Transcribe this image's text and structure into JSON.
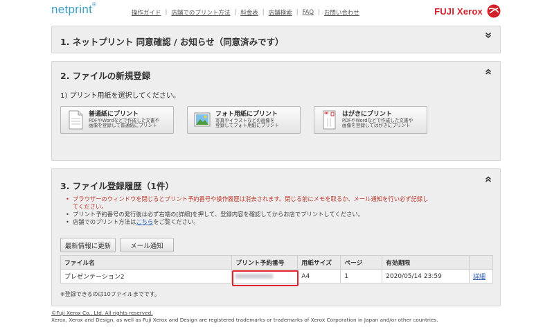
{
  "header": {
    "logo": "netprint",
    "logo_mark": "®",
    "nav": [
      "操作ガイド",
      "店舗でのプリント方法",
      "料金表",
      "店舗検索",
      "FAQ",
      "お問い合わせ"
    ],
    "brand": "FUJI Xerox",
    "brand_color": "#d2202a"
  },
  "panel1": {
    "title": "1. ネットプリント 同意確認 / お知らせ（同意済みです）",
    "toggle_icon": "chevron-double-down-icon"
  },
  "panel2": {
    "title": "2. ファイルの新規登録",
    "toggle_icon": "chevron-double-up-icon",
    "subtitle": "1) プリント用紙を選択してください。",
    "buttons": [
      {
        "title": "普通紙にプリント",
        "desc1": "PDFやWordなどで作成した文書や",
        "desc2": "画像を登録して普通紙にプリント",
        "icon": "document-icon"
      },
      {
        "title": "フォト用紙にプリント",
        "desc1": "写真やイラストなどの画像を",
        "desc2": "登録してフォト用紙にプリント",
        "icon": "photo-icon"
      },
      {
        "title": "はがきにプリント",
        "desc1": "PDFやWordなどで作成した文書や",
        "desc2": "画像を登録してはがきにプリント",
        "icon": "postcard-icon"
      }
    ]
  },
  "panel3": {
    "title": "3. ファイル登録履歴（1件）",
    "toggle_icon": "chevron-double-up-icon",
    "notes": {
      "n1a": "ブラウザーのウィンドウを閉じるとプリント予約番号や操作履歴は消去されます。閉じる前にメモを取るか、メール通知を行い必ず記録し",
      "n1b": "てください。",
      "n2": "プリント予約番号の発行後は必ず右端の[詳細]を押して、登録内容を確認してからお店でプリントしてください。",
      "n3_pre": "店舗でのプリント方法は",
      "n3_link": "こちら",
      "n3_post": "をご覧ください。"
    },
    "refresh_button": "最新情報に更新",
    "mail_button": "メール通知",
    "table": {
      "headers": [
        "ファイル名",
        "プリント予約番号",
        "用紙サイズ",
        "ページ",
        "有効期限",
        ""
      ],
      "rows": [
        {
          "file": "プレゼンテーション2",
          "number": "",
          "size": "A4",
          "pages": "1",
          "expires": "2020/05/14 23:59",
          "detail": "詳細"
        }
      ]
    },
    "limit_note": "※登録できるのは10ファイルまでです。"
  },
  "footer": {
    "copyright": "©Fuji Xerox Co., Ltd. All rights reserved.",
    "trademark": "Xerox, Xerox and Design, as well as Fuji Xerox and Design are registered trademarks or trademarks of Xerox Corporation in Japan and/or other countries."
  },
  "colors": {
    "accent": "#3aa0c9",
    "warning_text": "#c0392b",
    "highlight_border": "#e1232b"
  }
}
